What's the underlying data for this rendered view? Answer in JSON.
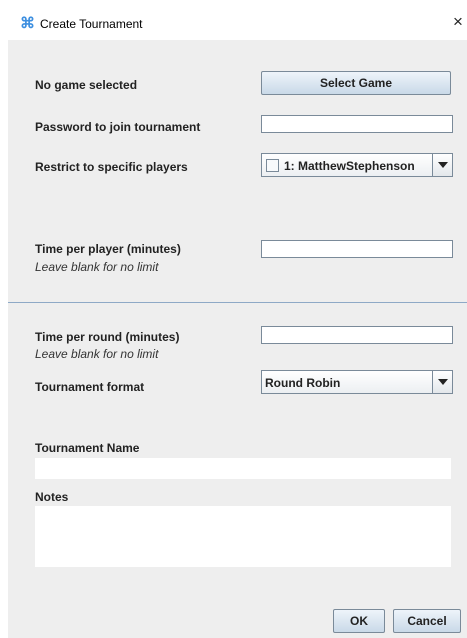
{
  "window": {
    "title": "Create Tournament",
    "close_glyph": "×",
    "icon": "app-command-icon",
    "accent_color": "#3d8fe0"
  },
  "game": {
    "status_label": "No game selected",
    "select_button_label": "Select Game"
  },
  "password": {
    "label": "Password to join tournament",
    "value": ""
  },
  "restrict_players": {
    "label": "Restrict to specific players",
    "selected_option": "1: MatthewStephenson",
    "checked": false
  },
  "time_per_player": {
    "label": "Time per player (minutes)",
    "hint": "Leave blank for no limit",
    "value": ""
  },
  "time_per_round": {
    "label": "Time per round (minutes)",
    "hint": "Leave blank for no limit",
    "value": ""
  },
  "format": {
    "label": "Tournament format",
    "selected_option": "Round Robin"
  },
  "name": {
    "label": "Tournament Name",
    "value": ""
  },
  "notes": {
    "label": "Notes",
    "value": ""
  },
  "actions": {
    "ok_label": "OK",
    "cancel_label": "Cancel"
  }
}
